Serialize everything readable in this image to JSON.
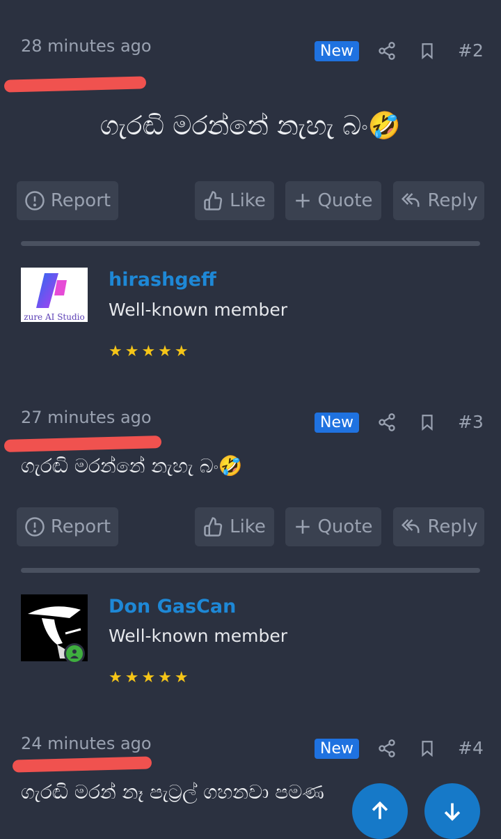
{
  "posts": [
    {
      "time": "28 minutes ago",
      "badge": "New",
      "number": "#2",
      "body": "ගැරඬි මරන්නේ නැහැ බං🤣"
    },
    {
      "time": "27 minutes ago",
      "badge": "New",
      "number": "#3",
      "body": "ගැරඬි මරන්නේ නැහැ බං🤣"
    },
    {
      "time": "24 minutes ago",
      "badge": "New",
      "number": "#4",
      "body": "ගැරඬි මරන් නෑ පැට්‍රල් ගහනවා පමණ"
    }
  ],
  "actions": {
    "report": "Report",
    "like": "Like",
    "quote": "Quote",
    "reply": "Reply"
  },
  "users": [
    {
      "name": "hirashgeff",
      "role": "Well-known member",
      "stars": "★★★★★",
      "avatar_caption": "zure AI Studio"
    },
    {
      "name": "Don GasCan",
      "role": "Well-known member",
      "stars": "★★★★★"
    }
  ],
  "colors": {
    "accent": "#1f72e0",
    "link": "#1e88d6",
    "highlight": "#f0524f",
    "background": "#2b3140"
  }
}
